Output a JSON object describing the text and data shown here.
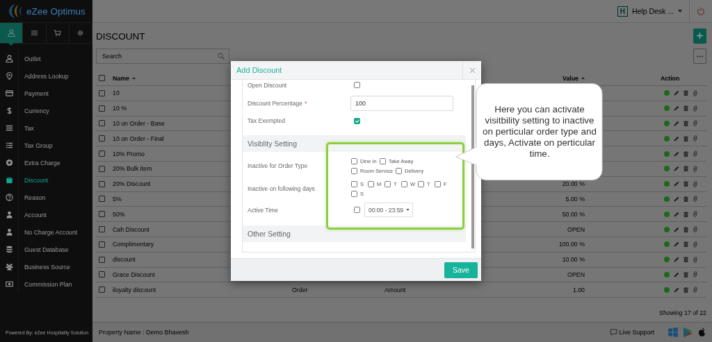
{
  "app": {
    "logo": "eZee Optimus"
  },
  "sidebar": {
    "tabs": [
      {
        "selected": true
      },
      {
        "selected": false
      },
      {
        "selected": false
      },
      {
        "selected": false
      }
    ],
    "items": [
      {
        "label": "Outlet",
        "selected": false
      },
      {
        "label": "Address Lookup",
        "selected": false
      },
      {
        "label": "Payment",
        "selected": false
      },
      {
        "label": "Currency",
        "selected": false
      },
      {
        "label": "Tax",
        "selected": false
      },
      {
        "label": "Tax Group",
        "selected": false
      },
      {
        "label": "Extra Charge",
        "selected": false
      },
      {
        "label": "Discount",
        "selected": true
      },
      {
        "label": "Reason",
        "selected": false
      },
      {
        "label": "Account",
        "selected": false
      },
      {
        "label": "No Charge Account",
        "selected": false
      },
      {
        "label": "Guest Database",
        "selected": false
      },
      {
        "label": "Business Source",
        "selected": false
      },
      {
        "label": "Commission Plan",
        "selected": false
      }
    ],
    "footer": "Powered By: eZee Hospitality Solution"
  },
  "topbar": {
    "badge": "H",
    "user": "Help Desk ..."
  },
  "page": {
    "title": "DISCOUNT",
    "search": {
      "placeholder": "Search"
    }
  },
  "table": {
    "all_checked": false,
    "columns": [
      {
        "label": "Name",
        "sortable": true
      },
      {
        "label": "Value",
        "sortable": true
      },
      {
        "label": "Action",
        "sortable": false
      }
    ],
    "rows": [
      {
        "name": "10",
        "checked": false
      },
      {
        "name": "10 %",
        "checked": false
      },
      {
        "name": "10 on Order - Base",
        "checked": false
      },
      {
        "name": "10 on Order - Final",
        "checked": false
      },
      {
        "name": "10% Promo",
        "checked": false
      },
      {
        "name": "20% Bulk item",
        "checked": false
      },
      {
        "name": "20% Discount",
        "checked": false,
        "value": "20.00 %"
      },
      {
        "name": "5%",
        "checked": false,
        "value": "5.00 %"
      },
      {
        "name": "50%",
        "checked": false,
        "value": "50.00 %"
      },
      {
        "name": "Cah Discount",
        "checked": false,
        "value": "OPEN"
      },
      {
        "name": "Complimentary",
        "checked": false,
        "value": "100.00 %"
      },
      {
        "name": "discount",
        "checked": false,
        "value": "10.00 %"
      },
      {
        "name": "Grace Discount",
        "checked": false,
        "value": "OPEN"
      },
      {
        "name": "iloyalty discount",
        "checked": false,
        "column_2": "Order",
        "column_3": "Amount",
        "value": "1.00"
      }
    ],
    "showing": "Showing 17 of 22"
  },
  "footer": {
    "property": "Property Name : Demo Bhavesh",
    "support": "Live Support"
  },
  "modal": {
    "title": "Add Discount",
    "fields": [
      {
        "kind": "checkbox",
        "label": "Open Discount",
        "checked": false
      },
      {
        "kind": "input",
        "label": "Discount Percentage",
        "required_mark": "*",
        "value": "100"
      },
      {
        "kind": "checkbox",
        "label": "Tax Exempted",
        "checked": true
      }
    ],
    "sections": [
      {
        "title": "Visiblity Setting",
        "rows": [
          {
            "kind": "options",
            "label": "Inactive for Order Type",
            "options": [
              {
                "label": "Dine In",
                "checked": false
              },
              {
                "label": "Take Away",
                "checked": false
              },
              {
                "label": "Room Service",
                "checked": false
              },
              {
                "label": "Delivery",
                "checked": false
              }
            ]
          },
          {
            "kind": "options",
            "label": "Inactive on following days",
            "options": [
              {
                "label": "S",
                "checked": false
              },
              {
                "label": "M",
                "checked": false
              },
              {
                "label": "T",
                "checked": false
              },
              {
                "label": "W",
                "checked": false
              },
              {
                "label": "T",
                "checked": false
              },
              {
                "label": "F",
                "checked": false
              },
              {
                "label": "S",
                "checked": false
              }
            ]
          },
          {
            "kind": "time",
            "label": "Active Time",
            "checked": false,
            "value": "00:00 - 23:59"
          }
        ]
      },
      {
        "title": "Other Setting"
      }
    ],
    "save": "Save"
  },
  "callout": {
    "text": "Here you can activate visitbility setting to inactive on perticular order type and days, Activate on perticular time."
  }
}
